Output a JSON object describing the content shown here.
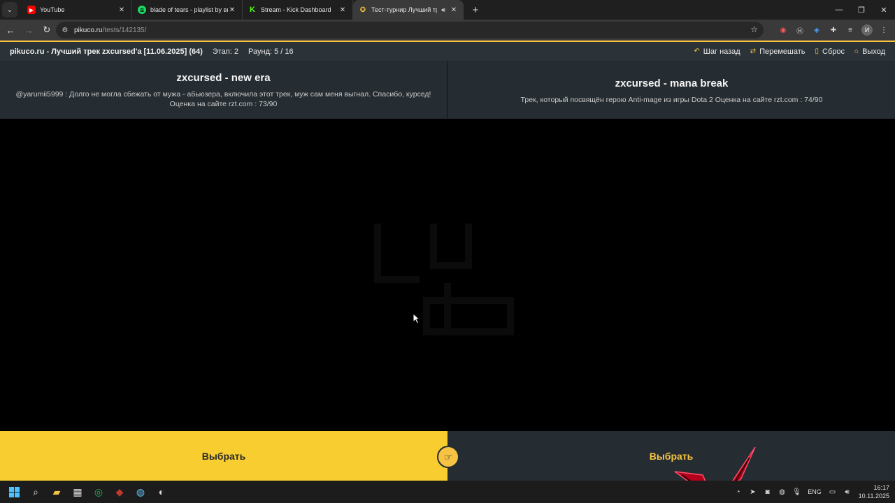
{
  "browser": {
    "tabs": [
      {
        "title": "YouTube",
        "icon": "youtube-icon"
      },
      {
        "title": "blade of tears - playlist by выб",
        "icon": "spotify-icon"
      },
      {
        "title": "Stream - Kick Dashboard",
        "icon": "kick-icon"
      },
      {
        "title": "Тест-турнир Лучший трек",
        "icon": "pikuco-icon",
        "active": true
      }
    ],
    "url_host": "pikuco.ru",
    "url_path": "/tests/142135/"
  },
  "header": {
    "title": "pikuco.ru - Лучший трек zxcursed'а [11.06.2025] (64)",
    "stage": "Этап: 2",
    "round": "Раунд: 5 / 16",
    "actions": {
      "back": "Шаг назад",
      "shuffle": "Перемешать",
      "reset": "Сброс",
      "exit": "Выход"
    }
  },
  "left_option": {
    "title": "zxcursed - new era",
    "description": "@yarumii5999 : Долго не могла сбежать от мужа - абьюзера, включила этот трек, муж сам меня выгнал. Спасибо, курсед!",
    "rating": "Оценка на сайте rzt.com : 73/90"
  },
  "right_option": {
    "title": "zxcursed - mana break",
    "description": "Трек, который посвящён герою Anti-mage из игры Dota 2 Оценка на сайте rzt.com : 74/90"
  },
  "choose": {
    "left_label": "Выбрать",
    "right_label": "Выбрать"
  },
  "taskbar": {
    "lang": "ENG",
    "time": "16:17",
    "date": "10.11.2025"
  },
  "colors": {
    "accent": "#f6c343",
    "panel": "#262d32",
    "header": "#2b3338",
    "choose_left": "#f8cd2f"
  }
}
